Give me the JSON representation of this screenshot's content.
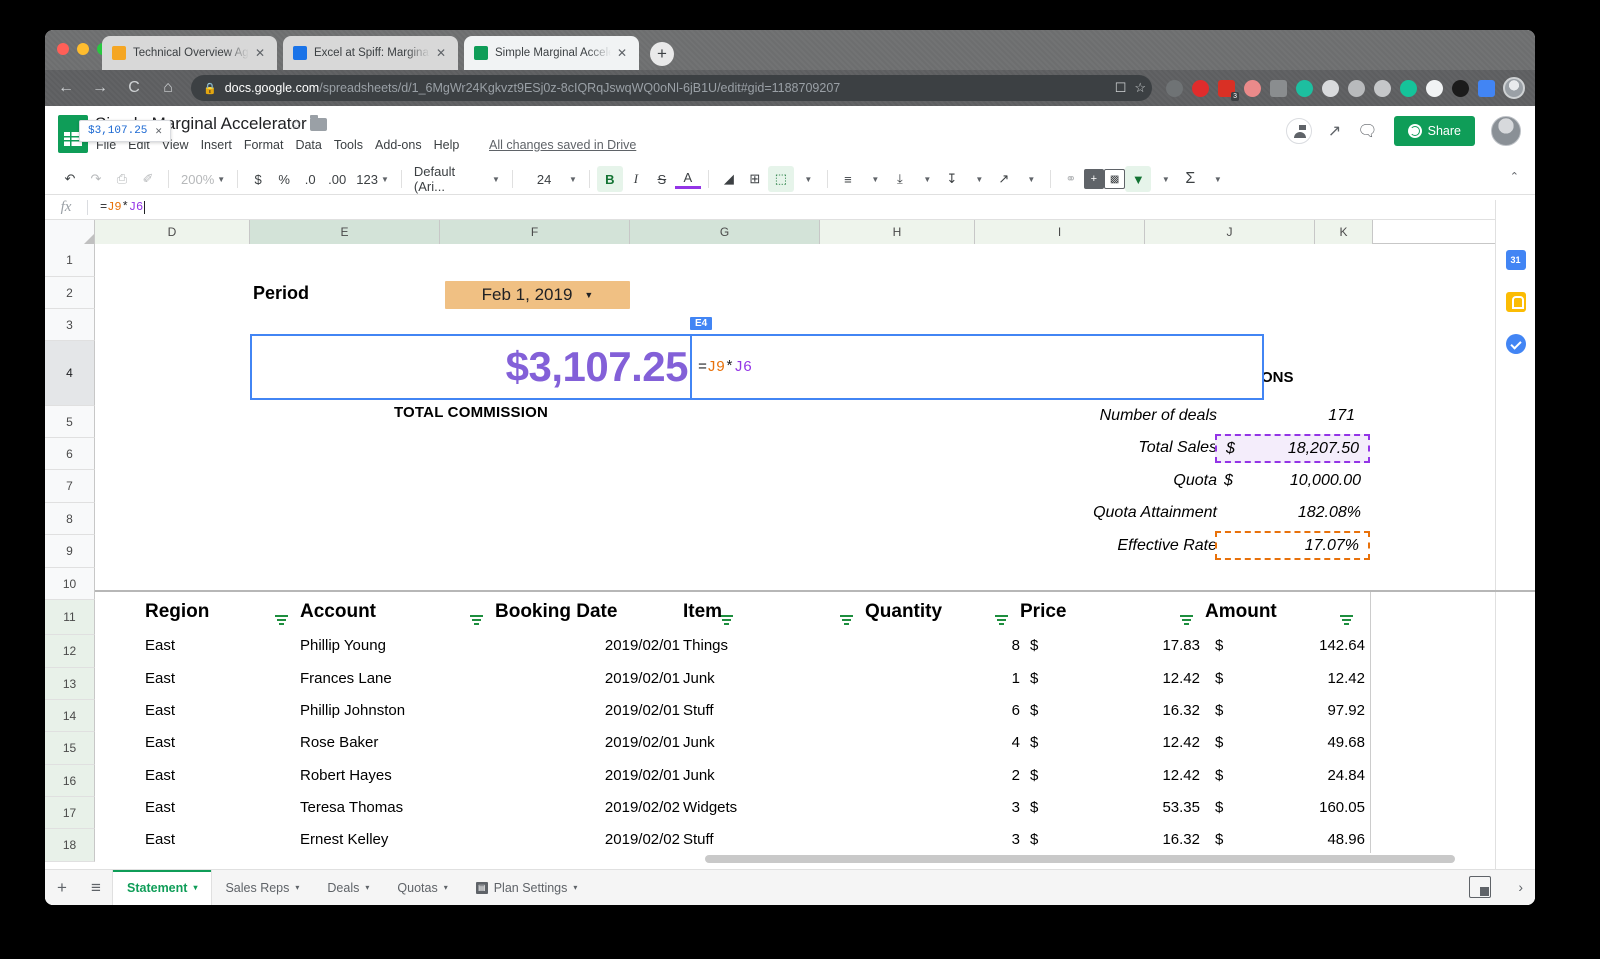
{
  "browser": {
    "tabs": [
      {
        "title": "Technical Overview Agenda - v",
        "favicon": "doc-icon",
        "active": false
      },
      {
        "title": "Excel at Spiff: Marginal Payout",
        "favicon": "spreadsheet-icon",
        "active": false
      },
      {
        "title": "Simple Marginal Accelerator - ",
        "favicon": "sheets-icon",
        "active": true
      }
    ],
    "new_tab_label": "+",
    "close_label": "✕",
    "nav": {
      "back": "←",
      "forward": "→",
      "reload": "C",
      "home": "⌂"
    },
    "omnibox": {
      "lock": "🔒",
      "host": "docs.google.com",
      "path": "/spreadsheets/d/1_6MgWr24Kgkvzt9ESj0z-8cIQRqJswqWQ0oNl-6jB1U/edit#gid=1188709207",
      "cast": "⬚",
      "bookmark": "☆"
    },
    "extensions": [
      {
        "name": "goggles-extension",
        "color": "#6f7375"
      },
      {
        "name": "shield-extension",
        "color": "#e02c2c"
      },
      {
        "name": "recorder-extension",
        "color": "#d93025",
        "badge": "3"
      },
      {
        "name": "cross-extension",
        "color": "#ea8a8a"
      },
      {
        "name": "scissors-extension",
        "color": "#8a8d8f"
      },
      {
        "name": "momentum-extension",
        "color": "#1dbfa0"
      },
      {
        "name": "smiley-extension",
        "color": "#d8dadc"
      },
      {
        "name": "target-extension",
        "color": "#b8babc"
      },
      {
        "name": "circle-a-extension",
        "color": "#c5c7c9"
      },
      {
        "name": "grammar-extension",
        "color": "#15c39a"
      },
      {
        "name": "white-circle-extension",
        "color": "#f1f3f4"
      },
      {
        "name": "black-circle-extension",
        "color": "#1b1b1b"
      },
      {
        "name": "video-extension",
        "color": "#4285f4"
      }
    ],
    "profile_avatar": "profile-avatar"
  },
  "docs": {
    "title": "Simple Marginal Accelerator",
    "star": "☆",
    "menus": [
      "File",
      "Edit",
      "View",
      "Insert",
      "Format",
      "Data",
      "Tools",
      "Add-ons",
      "Help"
    ],
    "save_status": "All changes saved in Drive",
    "share_label": "Share",
    "header_icons": [
      "presenting-icon",
      "activity-chart-icon",
      "comment-icon"
    ]
  },
  "toolbar": {
    "undo": "↶",
    "redo": "↷",
    "print": "⎙",
    "paint": "✐",
    "zoom": "200%",
    "currency": "$",
    "percent": "%",
    "decrease_decimal": ".0",
    "increase_decimal": ".00",
    "number_format": "123",
    "font": "Default (Ari...",
    "font_size": "24",
    "bold": "B",
    "italic": "I",
    "strikethrough": "S",
    "text_color": "A",
    "fill_color": "◢",
    "borders": "⊞",
    "merge": "⬚",
    "halign": "≡",
    "valign": "⤓",
    "wrap": "↧",
    "rotate": "↗",
    "link": "⚭",
    "comment_add": "⊞",
    "chart": "Ὄa",
    "filter": "▼",
    "functions": "Σ",
    "collapse": "⌃",
    "autocomplete_suggestion": "$3,107.25",
    "autocomplete_close": "✕"
  },
  "formula_bar": {
    "fx": "fx",
    "formula_prefix": "=",
    "ref1": "J9",
    "operator": "*",
    "ref2": "J6"
  },
  "grid": {
    "columns": [
      "D",
      "E",
      "F",
      "G",
      "H",
      "I",
      "J",
      "K"
    ],
    "highlighted_columns": [
      "E",
      "F",
      "G"
    ],
    "rows": [
      "1",
      "2",
      "3",
      "4",
      "5",
      "6",
      "7",
      "8",
      "9",
      "10",
      "11",
      "12",
      "13",
      "14",
      "15",
      "16",
      "17",
      "18"
    ],
    "active_row": "4",
    "active_cell_ref": "E4"
  },
  "sheet": {
    "period_label": "Period",
    "period_value": "Feb 1, 2019",
    "period_dropdown_caret": "▼",
    "commission_value": "$3,107.25",
    "commission_label": "TOTAL COMMISSION",
    "commissions_label_fragment": "ONS",
    "edit_formula": {
      "prefix": "=",
      "ref1": "J9",
      "op": "*",
      "ref2": "J6"
    },
    "metrics": [
      {
        "label": "Number of deals",
        "currency": "",
        "value": "171",
        "highlight": "none"
      },
      {
        "label": "Total Sales",
        "currency": "$",
        "value": "18,207.50",
        "highlight": "purple"
      },
      {
        "label": "Quota",
        "currency": "$",
        "value": "10,000.00",
        "highlight": "none"
      },
      {
        "label": "Quota Attainment",
        "currency": "",
        "value": "182.08%",
        "highlight": "none"
      },
      {
        "label": "Effective Rate",
        "currency": "",
        "value": "17.07%",
        "highlight": "orange"
      }
    ],
    "table_headers": [
      "Region",
      "Account",
      "Booking Date",
      "Item",
      "Quantity",
      "Price",
      "Amount"
    ],
    "table_rows": [
      {
        "region": "East",
        "account": "Phillip Young",
        "date": "2019/02/01",
        "item": "Things",
        "qty": "8",
        "cur1": "$",
        "price": "17.83",
        "cur2": "$",
        "amount": "142.64"
      },
      {
        "region": "East",
        "account": "Frances Lane",
        "date": "2019/02/01",
        "item": "Junk",
        "qty": "1",
        "cur1": "$",
        "price": "12.42",
        "cur2": "$",
        "amount": "12.42"
      },
      {
        "region": "East",
        "account": "Phillip Johnston",
        "date": "2019/02/01",
        "item": "Stuff",
        "qty": "6",
        "cur1": "$",
        "price": "16.32",
        "cur2": "$",
        "amount": "97.92"
      },
      {
        "region": "East",
        "account": "Rose Baker",
        "date": "2019/02/01",
        "item": "Junk",
        "qty": "4",
        "cur1": "$",
        "price": "12.42",
        "cur2": "$",
        "amount": "49.68"
      },
      {
        "region": "East",
        "account": "Robert Hayes",
        "date": "2019/02/01",
        "item": "Junk",
        "qty": "2",
        "cur1": "$",
        "price": "12.42",
        "cur2": "$",
        "amount": "24.84"
      },
      {
        "region": "East",
        "account": "Teresa Thomas",
        "date": "2019/02/02",
        "item": "Widgets",
        "qty": "3",
        "cur1": "$",
        "price": "53.35",
        "cur2": "$",
        "amount": "160.05"
      },
      {
        "region": "East",
        "account": "Ernest Kelley",
        "date": "2019/02/02",
        "item": "Stuff",
        "qty": "3",
        "cur1": "$",
        "price": "16.32",
        "cur2": "$",
        "amount": "48.96"
      }
    ]
  },
  "sheet_tabs": {
    "add": "+",
    "all_sheets": "≡",
    "tabs": [
      {
        "label": "Statement",
        "active": true,
        "protected": false
      },
      {
        "label": "Sales Reps",
        "active": false,
        "protected": false
      },
      {
        "label": "Deals",
        "active": false,
        "protected": false
      },
      {
        "label": "Quotas",
        "active": false,
        "protected": false
      },
      {
        "label": "Plan Settings",
        "active": false,
        "protected": true
      }
    ],
    "caret": "▾",
    "protected_glyph": "▤",
    "explore": "explore-icon",
    "expand": "›"
  },
  "side_panel": {
    "icons": [
      {
        "name": "google-calendar-icon",
        "text": "31"
      },
      {
        "name": "google-keep-icon",
        "text": ""
      },
      {
        "name": "google-tasks-icon",
        "text": ""
      }
    ]
  },
  "colors": {
    "accent_green": "#0f9d58",
    "selection_blue": "#4285f4",
    "commission_purple": "#8360d8",
    "period_tan": "#f0c083",
    "ref_orange": "#e8710a",
    "ref_purple": "#9334e6"
  }
}
